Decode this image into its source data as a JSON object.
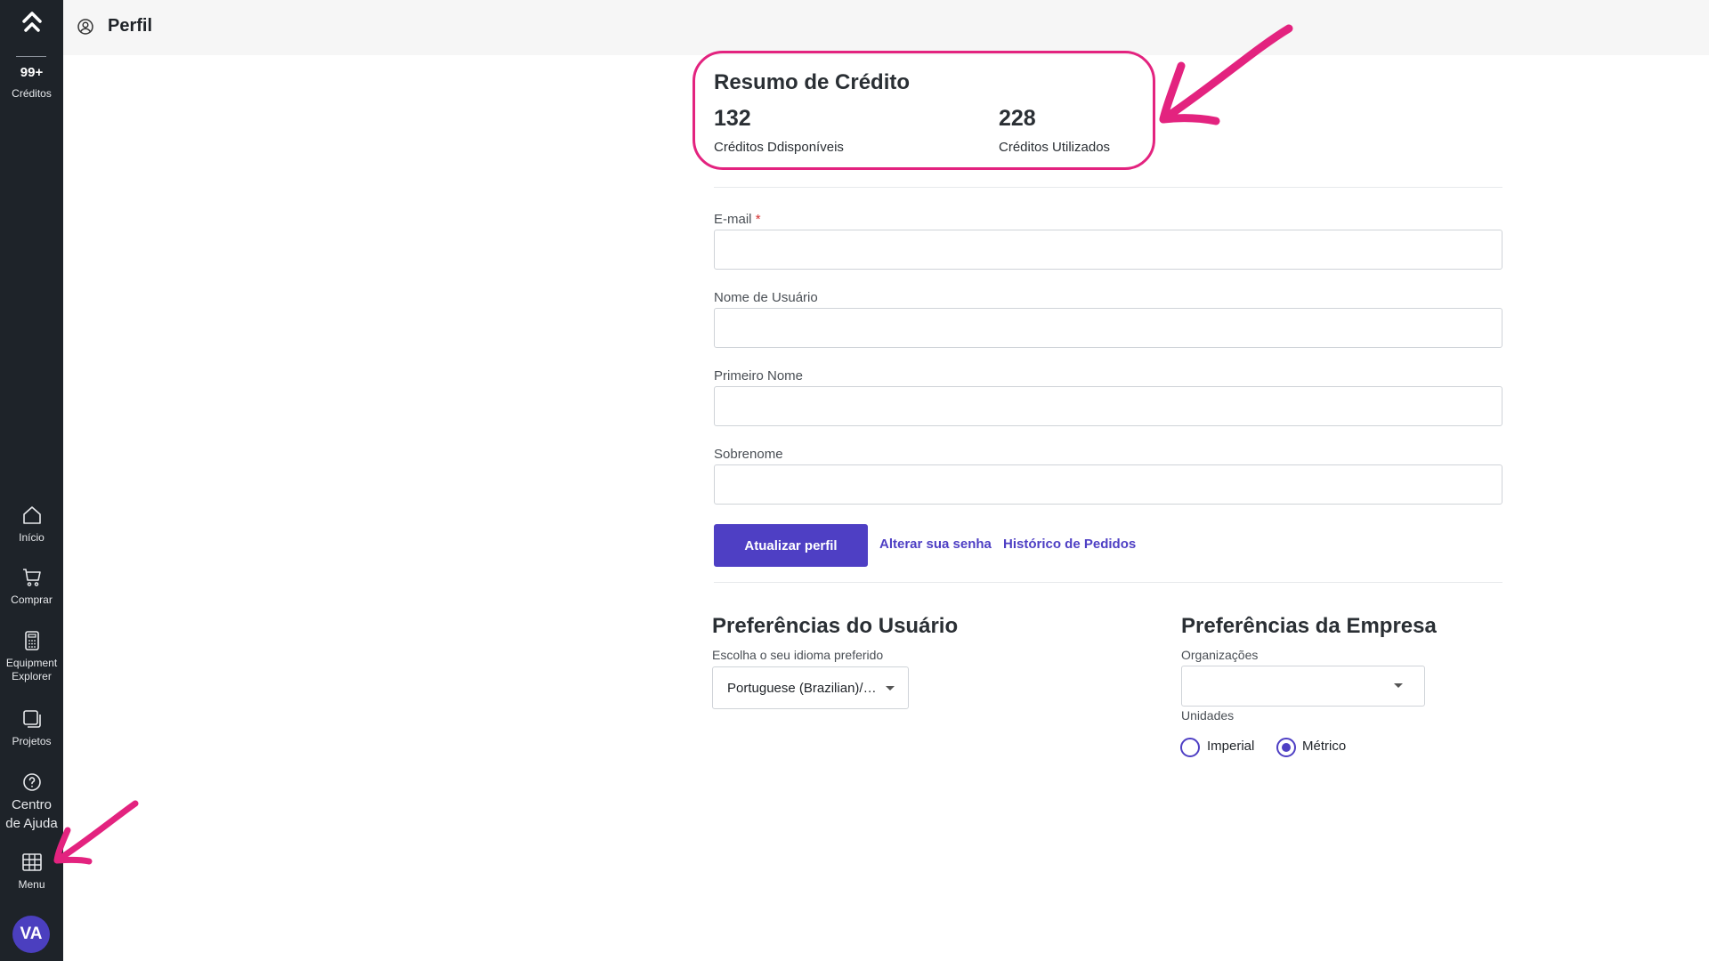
{
  "sidebar": {
    "credits_count": "99+",
    "credits_label": "Créditos",
    "items": [
      {
        "label": "Início"
      },
      {
        "label": "Comprar"
      },
      {
        "label": "Equipment\nExplorer"
      },
      {
        "label": "Projetos"
      },
      {
        "label": "Centro\nde Ajuda"
      },
      {
        "label": "Menu"
      }
    ],
    "avatar_initials": "VA"
  },
  "header": {
    "title": "Perfil",
    "icon": "user-circle-icon"
  },
  "credit_summary": {
    "title": "Resumo de Crédito",
    "available_value": "132",
    "available_label": "Créditos Ddisponíveis",
    "used_value": "228",
    "used_label": "Créditos Utilizados",
    "highlight_color": "#e3237f"
  },
  "form": {
    "email_label": "E-mail",
    "email_required": "*",
    "email_value": "",
    "username_label": "Nome de Usuário",
    "username_value": "",
    "first_name_label": "Primeiro Nome",
    "first_name_value": "",
    "last_name_label": "Sobrenome",
    "last_name_value": "",
    "update_button": "Atualizar perfil",
    "change_password_link": "Alterar sua senha",
    "order_history_link": "Histórico de Pedidos"
  },
  "user_prefs": {
    "title": "Preferências do Usuário",
    "language_label": "Escolha o seu idioma preferido",
    "language_value": "Portuguese (Brazilian)/Português (Brasil)"
  },
  "company_prefs": {
    "title": "Preferências da Empresa",
    "org_label": "Organizações",
    "org_value": "",
    "units_label": "Unidades",
    "units_options": [
      "Imperial",
      "Métrico"
    ],
    "units_selected": "Métrico"
  },
  "colors": {
    "accent": "#4e3fc4",
    "sidebar_bg": "#1e2329",
    "annotation": "#e3237f"
  }
}
